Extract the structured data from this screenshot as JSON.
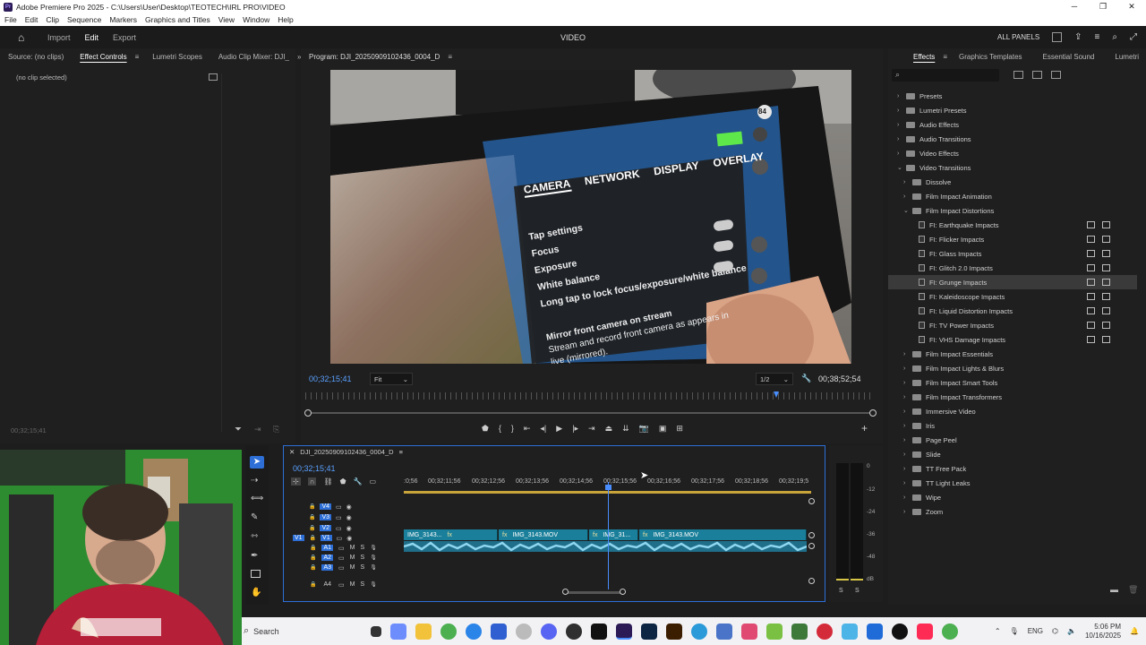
{
  "titlebar": {
    "title": "Adobe Premiere Pro 2025 - C:\\Users\\User\\Desktop\\TEOTECH\\IRL PRO\\VIDEO",
    "minimize": "─",
    "maximize": "❐",
    "close": "✕"
  },
  "menu": [
    "File",
    "Edit",
    "Clip",
    "Sequence",
    "Markers",
    "Graphics and Titles",
    "View",
    "Window",
    "Help"
  ],
  "header": {
    "workspaces": [
      "Import",
      "Edit",
      "Export"
    ],
    "active_workspace": "Edit",
    "center_title": "VIDEO",
    "all_panels": "ALL PANELS"
  },
  "source_panel": {
    "tabs": [
      "Source: (no clips)",
      "Effect Controls",
      "Lumetri Scopes",
      "Audio Clip Mixer: DJI_"
    ],
    "no_clip": "(no clip selected)",
    "timecode": "00;32;15;41"
  },
  "program": {
    "tab": "Program: DJI_20250909102436_0004_D",
    "timecode_in": "00;32;15;41",
    "fit": "Fit",
    "resolution": "1/2",
    "timecode_out": "00;38;52;54",
    "video_overlay": {
      "tabs": [
        "CAMERA",
        "NETWORK",
        "DISPLAY",
        "OVERLAY"
      ],
      "items": [
        "Tap settings",
        "Focus",
        "Exposure",
        "White balance",
        "Long tap to lock focus/exposure/white balance",
        "Mirror front camera on stream",
        "Stream and record front camera as appears in",
        "live (mirrored)."
      ],
      "battery": "84"
    }
  },
  "effects": {
    "tabs": [
      "Effects",
      "Graphics Templates",
      "Essential Sound",
      "Lumetri"
    ],
    "tree": [
      {
        "label": "Presets",
        "level": 0,
        "open": false
      },
      {
        "label": "Lumetri Presets",
        "level": 0,
        "open": false
      },
      {
        "label": "Audio Effects",
        "level": 0,
        "open": false
      },
      {
        "label": "Audio Transitions",
        "level": 0,
        "open": false
      },
      {
        "label": "Video Effects",
        "level": 0,
        "open": false
      },
      {
        "label": "Video Transitions",
        "level": 0,
        "open": true
      },
      {
        "label": "Dissolve",
        "level": 1,
        "open": false
      },
      {
        "label": "Film Impact Animation",
        "level": 1,
        "open": false
      },
      {
        "label": "Film Impact Distortions",
        "level": 1,
        "open": true
      },
      {
        "label": "FI: Earthquake Impacts",
        "level": 2,
        "file": true
      },
      {
        "label": "FI: Flicker Impacts",
        "level": 2,
        "file": true
      },
      {
        "label": "FI: Glass Impacts",
        "level": 2,
        "file": true
      },
      {
        "label": "FI: Glitch 2.0 Impacts",
        "level": 2,
        "file": true
      },
      {
        "label": "FI: Grunge Impacts",
        "level": 2,
        "file": true,
        "selected": true
      },
      {
        "label": "FI: Kaleidoscope Impacts",
        "level": 2,
        "file": true
      },
      {
        "label": "FI: Liquid Distortion Impacts",
        "level": 2,
        "file": true
      },
      {
        "label": "FI: TV Power Impacts",
        "level": 2,
        "file": true
      },
      {
        "label": "FI: VHS Damage Impacts",
        "level": 2,
        "file": true
      },
      {
        "label": "Film Impact Essentials",
        "level": 1,
        "open": false
      },
      {
        "label": "Film Impact Lights & Blurs",
        "level": 1,
        "open": false
      },
      {
        "label": "Film Impact Smart Tools",
        "level": 1,
        "open": false
      },
      {
        "label": "Film Impact Transformers",
        "level": 1,
        "open": false
      },
      {
        "label": "Immersive Video",
        "level": 1,
        "open": false
      },
      {
        "label": "Iris",
        "level": 1,
        "open": false
      },
      {
        "label": "Page Peel",
        "level": 1,
        "open": false
      },
      {
        "label": "Slide",
        "level": 1,
        "open": false
      },
      {
        "label": "TT Free Pack",
        "level": 1,
        "open": false
      },
      {
        "label": "TT Light Leaks",
        "level": 1,
        "open": false
      },
      {
        "label": "Wipe",
        "level": 1,
        "open": false
      },
      {
        "label": "Zoom",
        "level": 1,
        "open": false
      }
    ]
  },
  "timeline": {
    "tab": "DJI_20250909102436_0004_D",
    "timecode": "00;32;15;41",
    "ruler": [
      ":0;56",
      "00;32;11;56",
      "00;32;12;56",
      "00;32;13;56",
      "00;32;14;56",
      "00;32;15;56",
      "00;32;16;56",
      "00;32;17;56",
      "00;32;18;56",
      "00;32;19;5"
    ],
    "video_tracks": [
      "V4",
      "V3",
      "V2",
      "V1"
    ],
    "audio_tracks": [
      "A1",
      "A2",
      "A3",
      "A4"
    ],
    "clips": [
      {
        "label": "IMG_3143...",
        "fx": "fx"
      },
      {
        "label": "IMG_3143.MOV",
        "fx": "fx"
      },
      {
        "label": "IMG_31...",
        "fx": "fx"
      },
      {
        "label": "IMG_3143.MOV",
        "fx": "fx"
      }
    ],
    "source_v1": "V1",
    "source_a1": "A1"
  },
  "meter": {
    "scale": [
      "0",
      "-12",
      "-24",
      "-36",
      "-48",
      "dB"
    ],
    "solo": [
      "S",
      "S"
    ]
  },
  "taskbar": {
    "search": "Search",
    "lang": "ENG",
    "time": "5:06 PM",
    "date": "10/16/2025"
  }
}
